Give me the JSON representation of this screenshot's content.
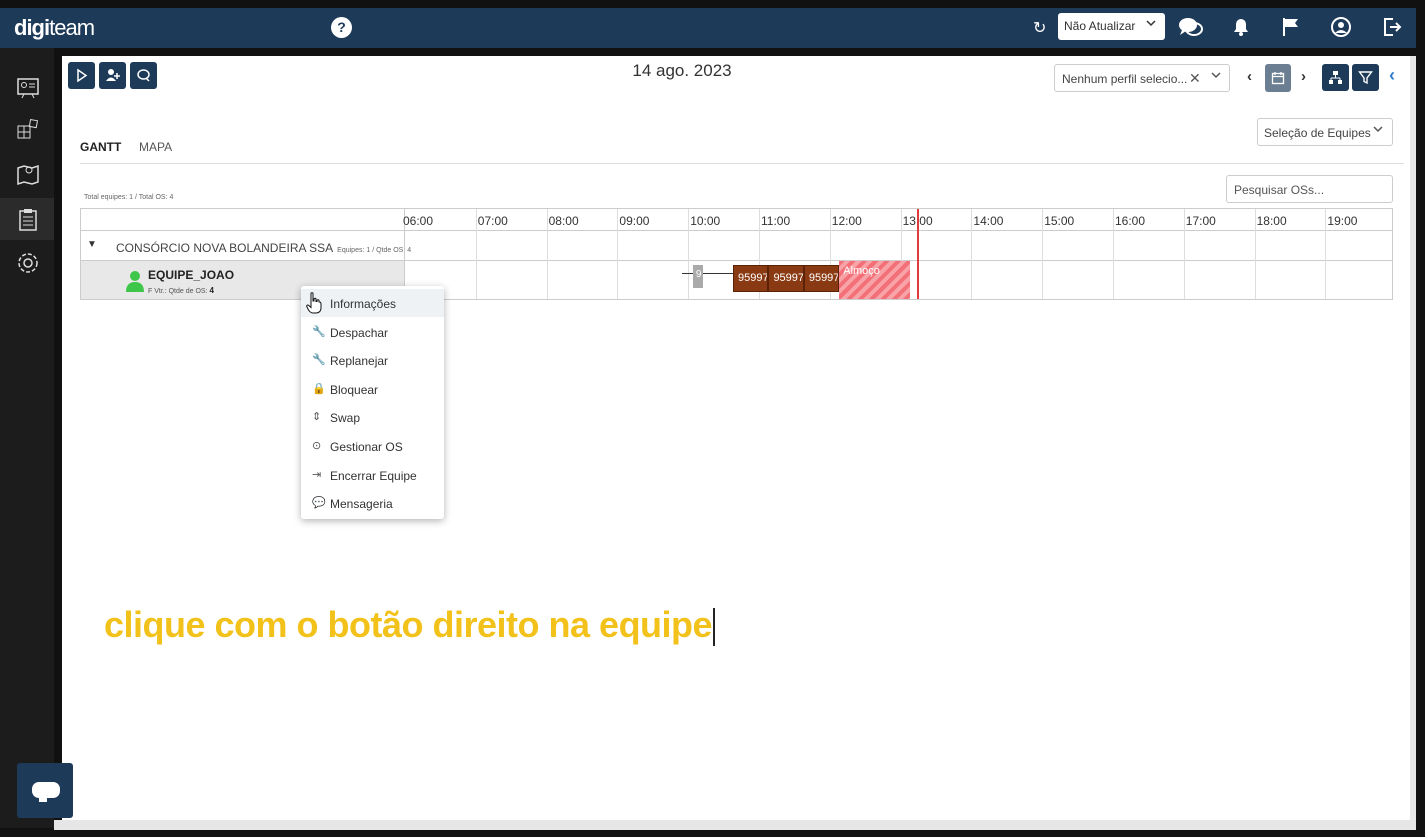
{
  "app": {
    "logo_part1": "digi",
    "logo_part2": "team",
    "help_glyph": "?"
  },
  "topbar": {
    "refresh_glyph": "↻",
    "auto_update_value": "Não Atualizar",
    "icons": [
      "chat-icon",
      "bell-icon",
      "flag-icon",
      "user-circle-icon",
      "logout-icon"
    ]
  },
  "sidebar": {
    "items": [
      "dashboard-icon",
      "modules-icon",
      "map-icon",
      "clipboard-icon",
      "settings-icon"
    ],
    "active": "clipboard-icon"
  },
  "toolbar": {
    "date": "14 ago. 2023",
    "profile_value": "Nenhum perfil selecio...",
    "clear_glyph": "✕",
    "prev_glyph": "‹",
    "next_glyph": "›",
    "collapse_glyph": "‹"
  },
  "tabs": [
    {
      "label": "GANTT",
      "active": true
    },
    {
      "label": "MAPA",
      "active": false
    }
  ],
  "team_selection_placeholder": "Seleção de Equipes",
  "search_os_placeholder": "Pesquisar OSs...",
  "totals": "Total equipes: 1 / Total OS: 4",
  "gantt": {
    "hours": [
      "06:00",
      "07:00",
      "08:00",
      "09:00",
      "10:00",
      "11:00",
      "12:00",
      "13:00",
      "14:00",
      "15:00",
      "16:00",
      "17:00",
      "18:00",
      "19:00"
    ],
    "group": {
      "name": "CONSÓRCIO NOVA BOLANDEIRA SSA",
      "summary": "Equipes: 1 / Qtde OS: 4",
      "expand_glyph": "▼"
    },
    "team": {
      "name": "EQUIPE_JOAO",
      "sub_label": "F Vtr.: Qtde de OS:",
      "os_count": "4"
    },
    "os_blocks": [
      {
        "label": "9",
        "type": "pending",
        "start": "10:04",
        "end": "10:12"
      },
      {
        "label": "95997",
        "type": "os",
        "start": "10:38",
        "end": "11:08"
      },
      {
        "label": "95997",
        "type": "os",
        "start": "11:08",
        "end": "11:38"
      },
      {
        "label": "95997",
        "type": "os",
        "start": "11:38",
        "end": "12:08"
      }
    ],
    "lunch": {
      "label": "Almoço",
      "start": "12:08",
      "end": "13:08"
    },
    "current_time": "13:14"
  },
  "context_menu": {
    "items": [
      {
        "label": "Informações",
        "icon": "info-icon",
        "glyph": "ⓘ"
      },
      {
        "label": "Despachar",
        "icon": "wrench-icon",
        "glyph": "🔧"
      },
      {
        "label": "Replanejar",
        "icon": "wrench-icon",
        "glyph": "🔧"
      },
      {
        "label": "Bloquear",
        "icon": "lock-icon",
        "glyph": "🔒"
      },
      {
        "label": "Swap",
        "icon": "swap-icon",
        "glyph": "⇕"
      },
      {
        "label": "Gestionar OS",
        "icon": "gear-circle-icon",
        "glyph": "⊙"
      },
      {
        "label": "Encerrar Equipe",
        "icon": "exit-icon",
        "glyph": "⇥"
      },
      {
        "label": "Mensageria",
        "icon": "message-icon",
        "glyph": "💬"
      }
    ],
    "hovered_index": 0
  },
  "caption": "clique com o botão direito na equipe"
}
